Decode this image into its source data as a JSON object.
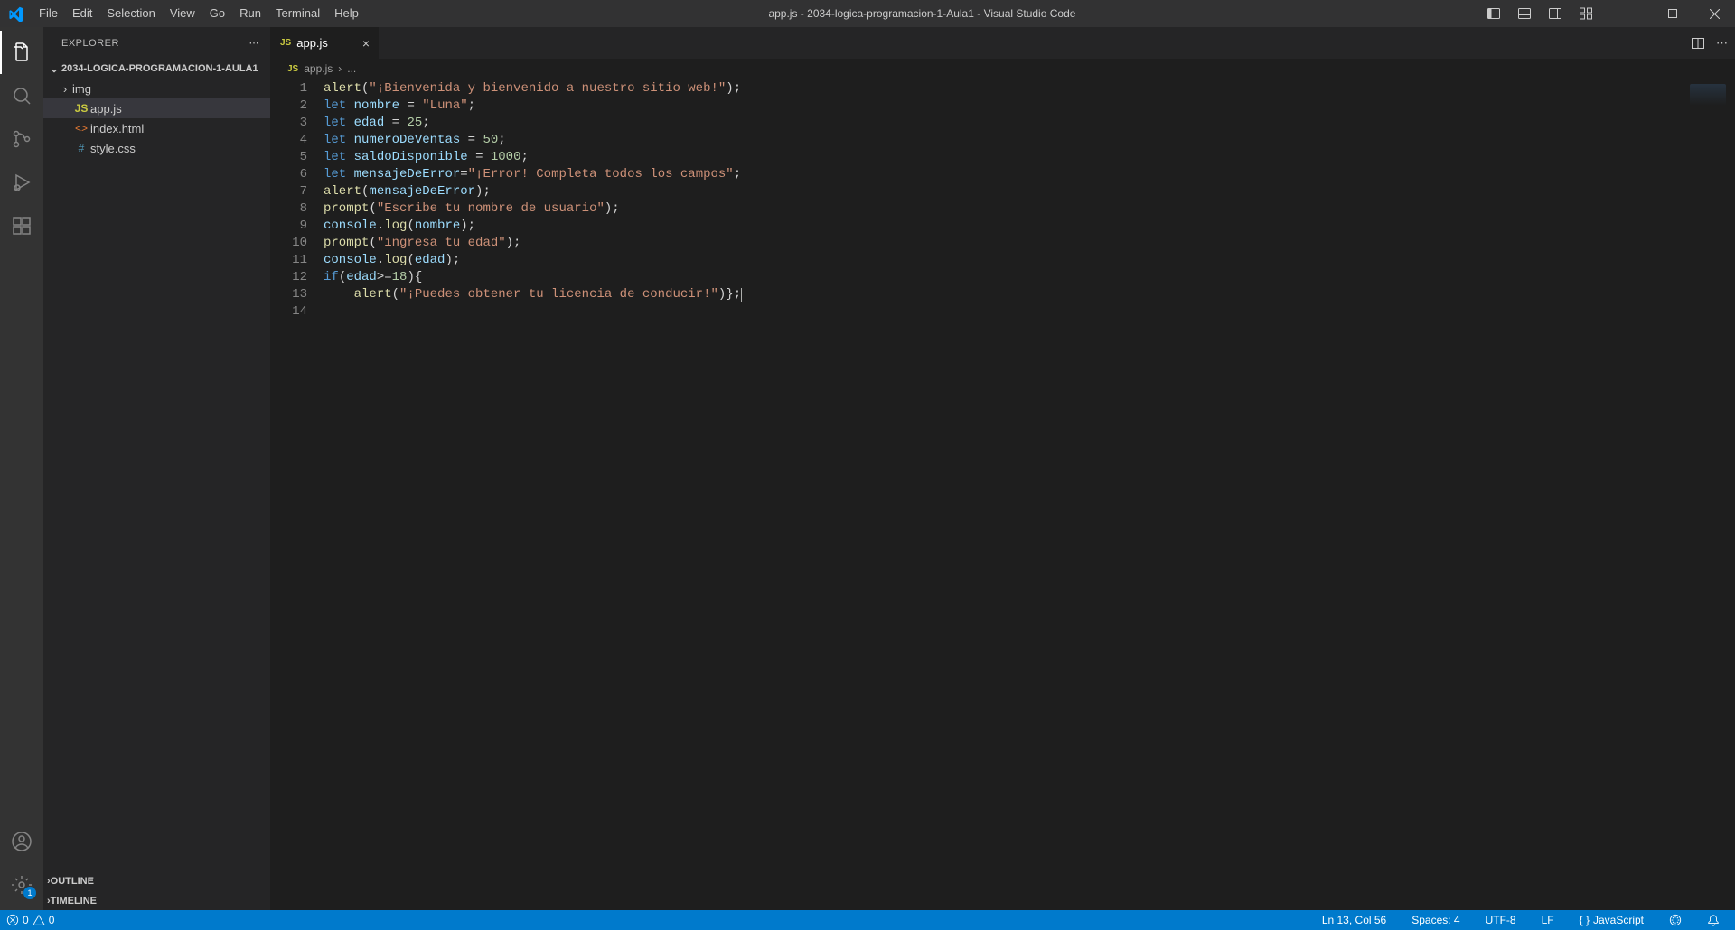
{
  "menu": [
    "File",
    "Edit",
    "Selection",
    "View",
    "Go",
    "Run",
    "Terminal",
    "Help"
  ],
  "window_title": "app.js - 2034-logica-programacion-1-Aula1 - Visual Studio Code",
  "sidebar": {
    "title": "EXPLORER",
    "project": "2034-LOGICA-PROGRAMACION-1-AULA1",
    "items": [
      {
        "label": "img",
        "kind": "folder"
      },
      {
        "label": "app.js",
        "kind": "js"
      },
      {
        "label": "index.html",
        "kind": "html"
      },
      {
        "label": "style.css",
        "kind": "css"
      }
    ],
    "outline": "OUTLINE",
    "timeline": "TIMELINE"
  },
  "tab": {
    "label": "app.js"
  },
  "breadcrumb": {
    "file": "app.js",
    "sep": "›",
    "rest": "..."
  },
  "gutter_lines": [
    "1",
    "2",
    "3",
    "4",
    "5",
    "6",
    "7",
    "8",
    "9",
    "10",
    "11",
    "12",
    "13",
    "14"
  ],
  "code": {
    "l1": {
      "fn": "alert",
      "s": "\"¡Bienvenida y bienvenido a nuestro sitio web!\""
    },
    "l2": {
      "kw": "let",
      "v": "nombre",
      "s": "\"Luna\""
    },
    "l3": {
      "kw": "let",
      "v": "edad",
      "n": "25"
    },
    "l4": {
      "kw": "let",
      "v": "numeroDeVentas",
      "n": "50"
    },
    "l5": {
      "kw": "let",
      "v": "saldoDisponible",
      "n": "1000"
    },
    "l6": {
      "kw": "let",
      "v": "mensajeDeError",
      "s": "\"¡Error! Completa todos los campos\""
    },
    "l7": {
      "fn": "alert",
      "v": "mensajeDeError"
    },
    "l8": {
      "fn": "prompt",
      "s": "\"Escribe tu nombre de usuario\""
    },
    "l9": {
      "o": "console",
      "fn": "log",
      "v": "nombre"
    },
    "l10": {
      "fn": "prompt",
      "s": "\"ingresa tu edad\""
    },
    "l11": {
      "o": "console",
      "fn": "log",
      "v": "edad"
    },
    "l12": {
      "kw": "if",
      "v": "edad",
      "n": "18"
    },
    "l13": {
      "fn": "alert",
      "s": "\"¡Puedes obtener tu licencia de conducir!\""
    }
  },
  "status": {
    "errors": "0",
    "warnings": "0",
    "ln_col": "Ln 13, Col 56",
    "spaces": "Spaces: 4",
    "encoding": "UTF-8",
    "eol": "LF",
    "lang": "JavaScript"
  },
  "settings_badge": "1"
}
